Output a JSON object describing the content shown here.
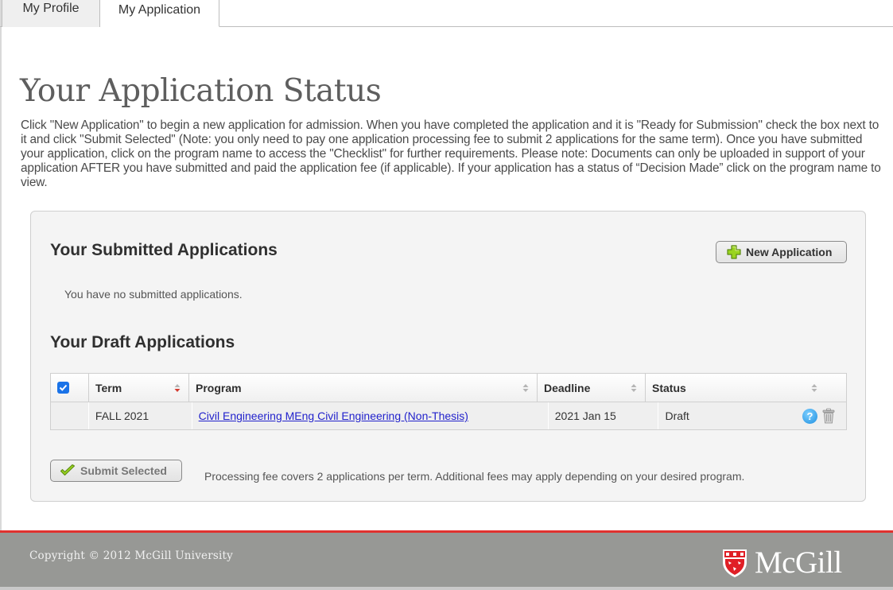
{
  "tabs": [
    {
      "label": "My Profile",
      "active": false
    },
    {
      "label": "My Application",
      "active": true
    }
  ],
  "page": {
    "title": "Your Application Status",
    "intro": "Click \"New Application\" to begin a new application for admission. When you have completed the application and it is \"Ready for Submission\" check the box next to it and click \"Submit Selected\" (Note: you only need to pay one application processing fee to submit 2 applications for the same term). Once you have submitted your application, click on the program name to access the \"Checklist\" for further requirements. Please note: Documents can only be uploaded in support of your application AFTER you have submitted and paid the application fee (if applicable). If your application has a status of “Decision Made” click on the program name to view."
  },
  "submitted": {
    "title": "Your Submitted Applications",
    "new_button": "New Application",
    "empty_message": "You have no submitted applications."
  },
  "drafts": {
    "title": "Your Draft Applications",
    "select_all_checked": true,
    "columns": [
      "Term",
      "Program",
      "Deadline",
      "Status"
    ],
    "rows": [
      {
        "term": "FALL 2021",
        "program": "Civil Engineering MEng Civil Engineering (Non-Thesis)",
        "deadline": "2021 Jan 15",
        "status": "Draft"
      }
    ],
    "submit_button": "Submit Selected",
    "fee_note": "Processing fee covers 2 applications per term. Additional fees may apply depending on your desired program."
  },
  "footer": {
    "copyright": "Copyright © 2012 McGill University",
    "logo_text": "McGill"
  },
  "colors": {
    "accent_red": "#e0322f",
    "footer_gray": "#979895",
    "link_blue": "#2222cc",
    "checkbox_blue": "#1a73e8"
  }
}
